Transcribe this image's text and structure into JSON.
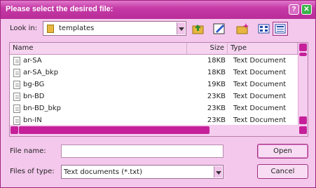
{
  "window": {
    "title": "Please select the desired file:",
    "help": "?",
    "close": "✕"
  },
  "lookin": {
    "label": "Look in:",
    "value": "templates"
  },
  "toolbar": [
    "up-folder",
    "edit-folder",
    "new-folder",
    "list-view",
    "details-view"
  ],
  "columns": {
    "name": "Name",
    "size": "Size",
    "type": "Type"
  },
  "files": [
    {
      "name": "ar-SA",
      "size": "18KB",
      "type": "Text Document"
    },
    {
      "name": "ar-SA_bkp",
      "size": "18KB",
      "type": "Text Document"
    },
    {
      "name": "bg-BG",
      "size": "19KB",
      "type": "Text Document"
    },
    {
      "name": "bn-BD",
      "size": "23KB",
      "type": "Text Document"
    },
    {
      "name": "bn-BD_bkp",
      "size": "23KB",
      "type": "Text Document"
    },
    {
      "name": "bn-IN",
      "size": "23KB",
      "type": "Text Document"
    }
  ],
  "filename": {
    "label": "File name:",
    "value": ""
  },
  "filetype": {
    "label": "Files of type:",
    "value": "Text documents (*.txt)"
  },
  "buttons": {
    "open": "Open",
    "cancel": "Cancel"
  },
  "colors": {
    "accent": "#c5209a",
    "background": "#f4c8ec"
  }
}
